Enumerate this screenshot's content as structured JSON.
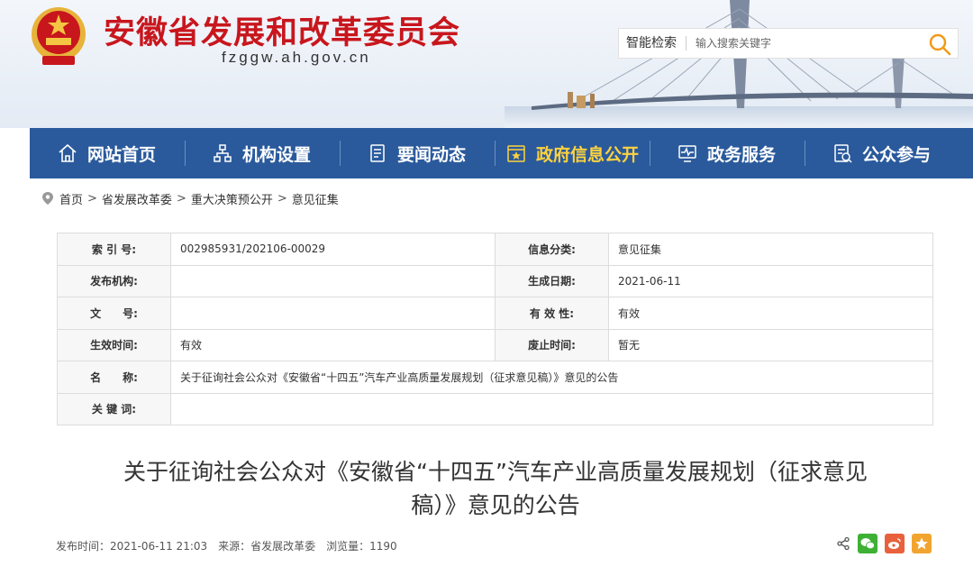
{
  "header": {
    "title": "安徽省发展和改革委员会",
    "domain": "fzggw.ah.gov.cn",
    "search": {
      "label": "智能检索",
      "placeholder": "输入搜索关键字"
    }
  },
  "nav": {
    "items": [
      {
        "label": "网站首页",
        "icon": "home-icon"
      },
      {
        "label": "机构设置",
        "icon": "org-chart-icon"
      },
      {
        "label": "要闻动态",
        "icon": "document-icon"
      },
      {
        "label": "政府信息公开",
        "icon": "info-disclosure-icon",
        "active": true
      },
      {
        "label": "政务服务",
        "icon": "service-monitor-icon"
      },
      {
        "label": "公众参与",
        "icon": "participation-icon"
      }
    ],
    "active_color": "#ffd23f"
  },
  "breadcrumb": [
    "首页",
    "省发展改革委",
    "重大决策预公开",
    "意见征集"
  ],
  "meta": {
    "index_label": "索 引 号:",
    "index_value": "002985931/202106-00029",
    "category_label": "信息分类:",
    "category_value": "意见征集",
    "publisher_label": "发布机构:",
    "publisher_value": "",
    "date_label": "生成日期:",
    "date_value": "2021-06-11",
    "docno_label": "文　　号:",
    "docno_value": "",
    "validity_label": "有 效 性:",
    "validity_value": "有效",
    "effective_label": "生效时间:",
    "effective_value": "有效",
    "expire_label": "废止时间:",
    "expire_value": "暂无",
    "name_label": "名　　称:",
    "name_value": "关于征询社会公众对《安徽省“十四五”汽车产业高质量发展规划（征求意见稿）》意见的公告",
    "keywords_label": "关 键 词:",
    "keywords_value": ""
  },
  "article": {
    "title_line1": "关于征询社会公众对《安徽省“十四五”汽车产业高质量发展规划（征求意见",
    "title_line2": "稿）》意见的公告",
    "publish_time": "发布时间：2021-06-11 21:03",
    "source": "来源：省发展改革委",
    "views": "浏览量：1190"
  },
  "colors": {
    "brand_red": "#c8161d",
    "nav_blue": "#2a5a9c",
    "search_orange": "#f29a1b"
  }
}
